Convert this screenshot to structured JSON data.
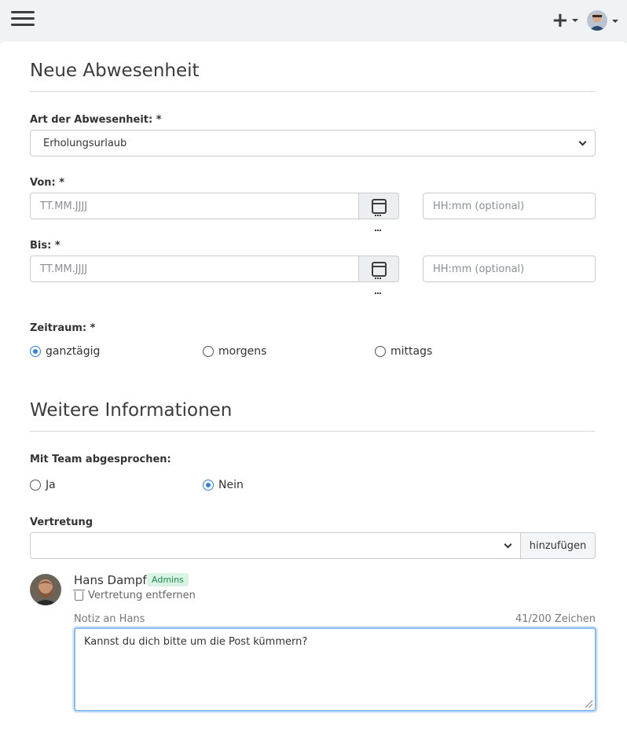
{
  "page": {
    "title": "Neue Abwesenheit",
    "section2_title": "Weitere Informationen"
  },
  "form": {
    "absence_type": {
      "label": "Art der Abwesenheit: *",
      "value": "Erholungsurlaub"
    },
    "from": {
      "label": "Von: *",
      "date_placeholder": "TT.MM.JJJJ",
      "time_placeholder": "HH:mm (optional)"
    },
    "to": {
      "label": "Bis: *",
      "date_placeholder": "TT.MM.JJJJ",
      "time_placeholder": "HH:mm (optional)"
    },
    "period": {
      "label": "Zeitraum: *",
      "options": [
        {
          "label": "ganztägig",
          "checked": true
        },
        {
          "label": "morgens",
          "checked": false
        },
        {
          "label": "mittags",
          "checked": false
        }
      ]
    },
    "team_agreed": {
      "label": "Mit Team abgesprochen:",
      "options": [
        {
          "label": "Ja",
          "checked": false
        },
        {
          "label": "Nein",
          "checked": true
        }
      ]
    },
    "substitute": {
      "label": "Vertretung",
      "select_value": "",
      "add_button": "hinzufügen"
    }
  },
  "substitute_entry": {
    "name": "Hans Dampf",
    "badge": "Admins",
    "remove_label": "Vertretung entfernen",
    "note_label": "Notiz an Hans",
    "counter": "41/200 Zeichen",
    "note_text": "Kannst du dich bitte um die Post kümmern?"
  },
  "colors": {
    "accent": "#2f80e0",
    "badge_bg": "#d9f3e4",
    "badge_text": "#1d8a4c"
  }
}
